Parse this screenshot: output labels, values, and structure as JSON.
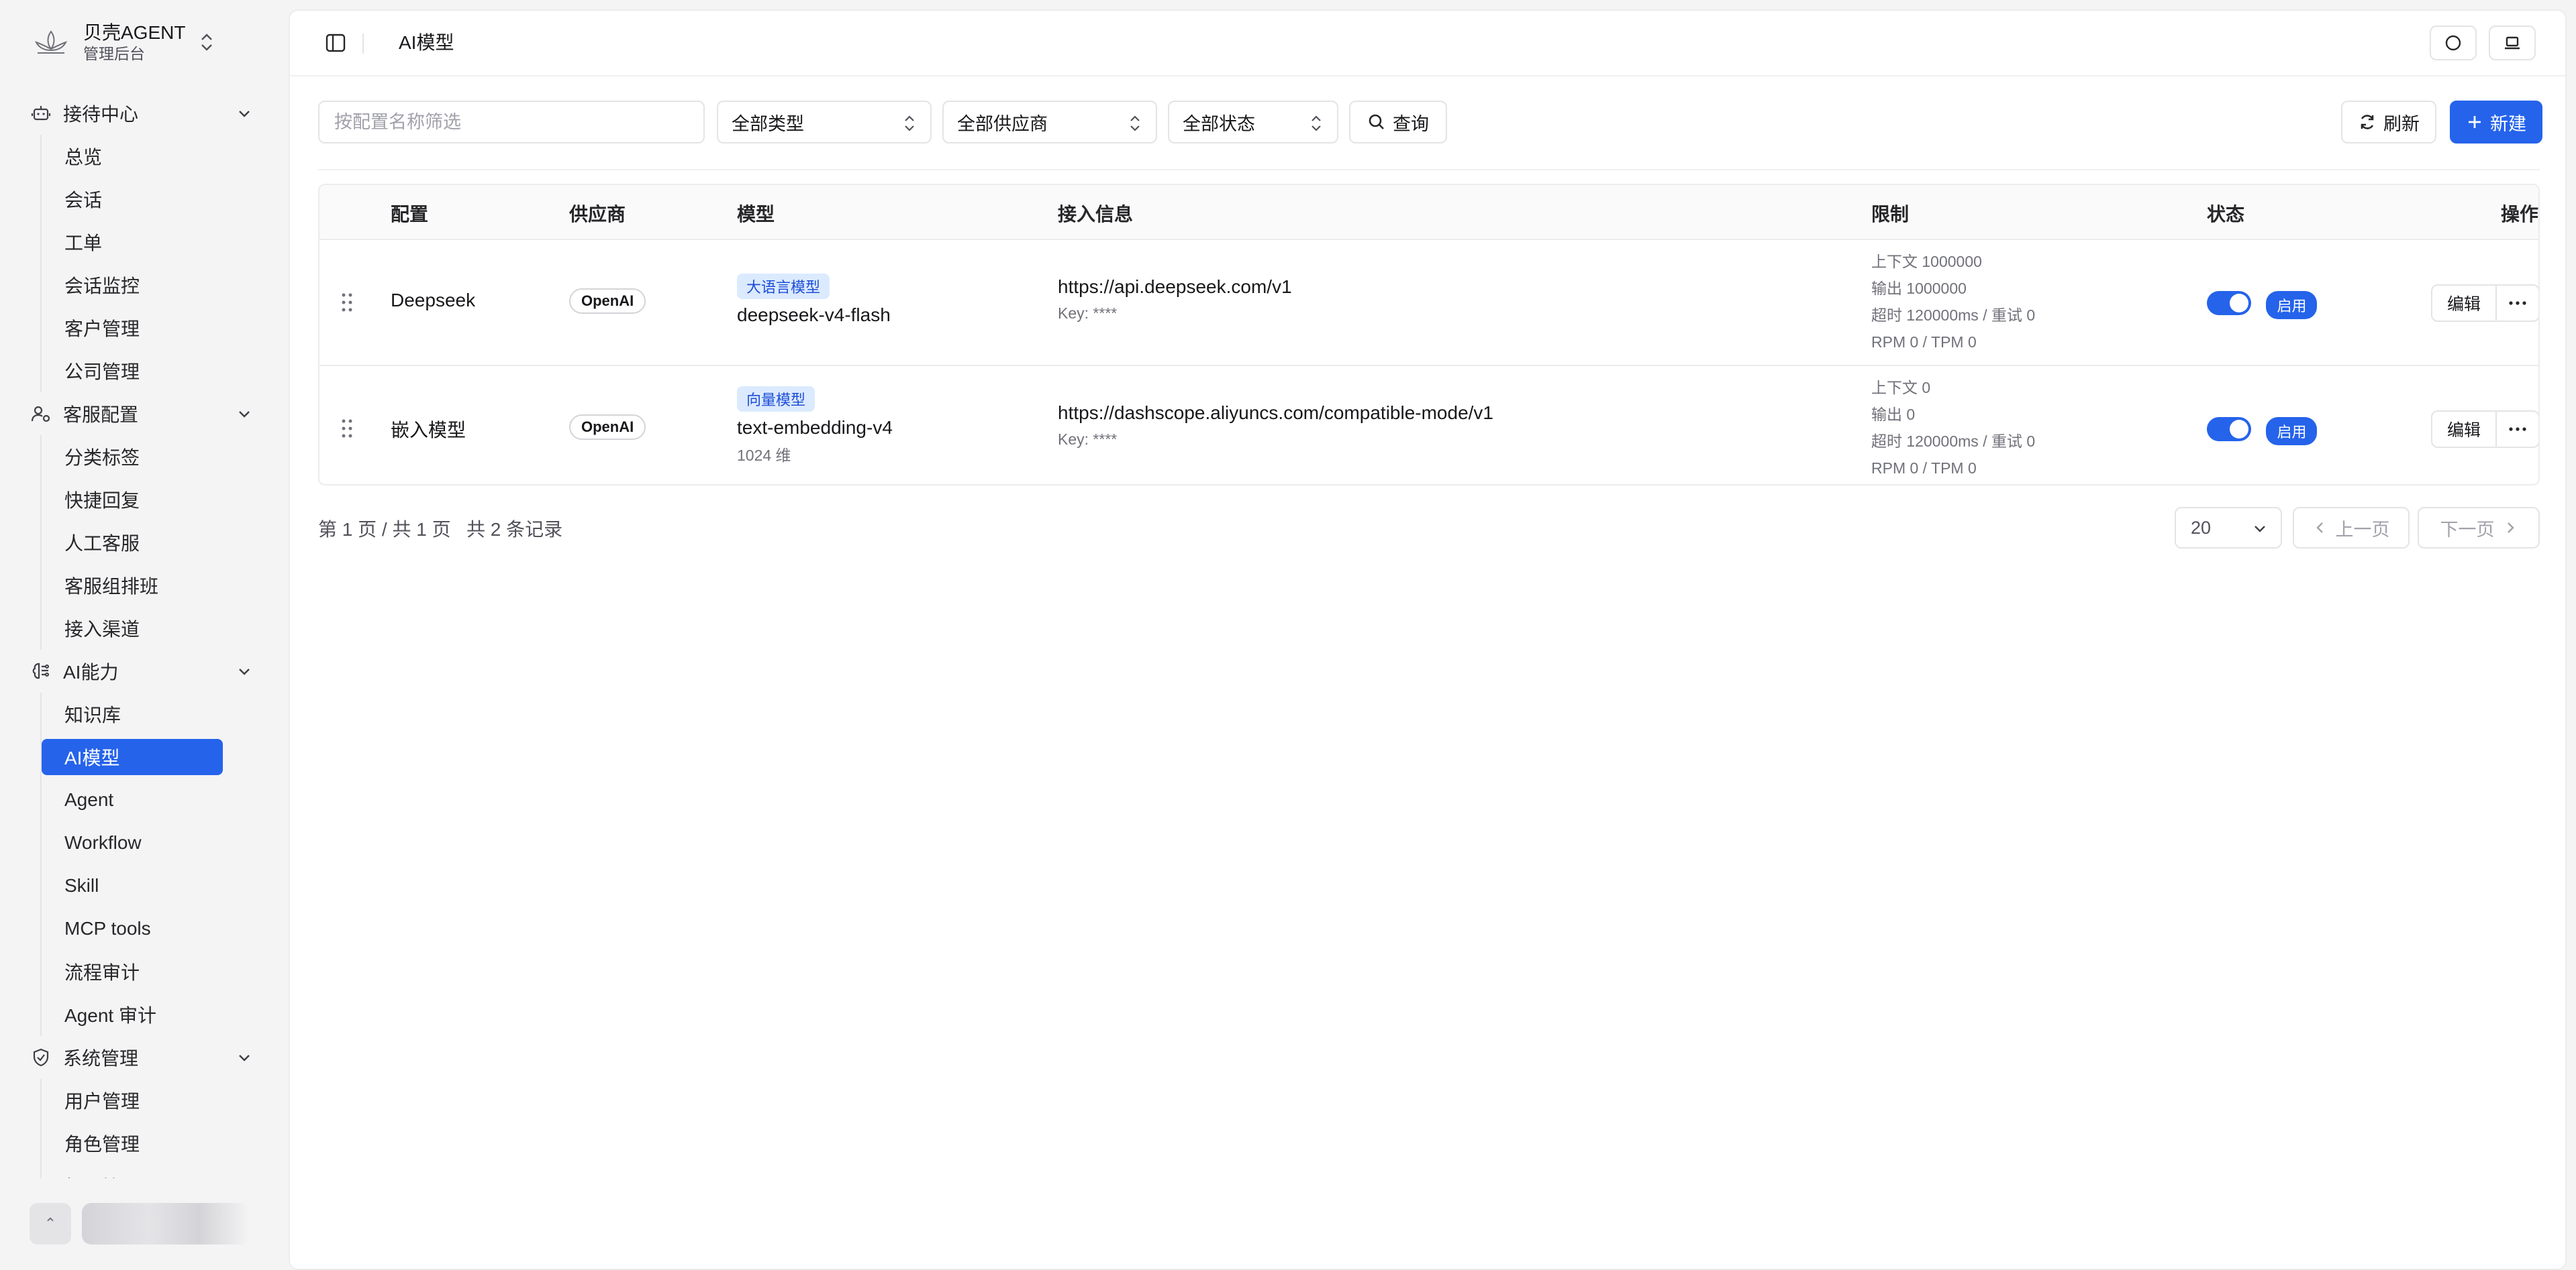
{
  "brand": {
    "title": "贝壳AGENT",
    "subtitle": "管理后台"
  },
  "sidebar": {
    "groups": [
      {
        "label": "接待中心",
        "items": [
          "总览",
          "会话",
          "工单",
          "会话监控",
          "客户管理",
          "公司管理"
        ]
      },
      {
        "label": "客服配置",
        "items": [
          "分类标签",
          "快捷回复",
          "人工客服",
          "客服组排班",
          "接入渠道"
        ]
      },
      {
        "label": "AI能力",
        "items": [
          "知识库",
          "AI模型",
          "Agent",
          "Workflow",
          "Skill",
          "MCP tools",
          "流程审计",
          "Agent 审计"
        ]
      },
      {
        "label": "系统管理",
        "items": [
          "用户管理",
          "角色管理",
          "权限管理"
        ]
      }
    ],
    "active_item": "AI模型"
  },
  "header": {
    "title": "AI模型"
  },
  "filters": {
    "search_placeholder": "按配置名称筛选",
    "type_select": "全部类型",
    "provider_select": "全部供应商",
    "status_select": "全部状态",
    "query_label": "查询",
    "refresh_label": "刷新",
    "new_label": "新建"
  },
  "table": {
    "columns": [
      "配置",
      "供应商",
      "模型",
      "接入信息",
      "限制",
      "状态",
      "操作"
    ],
    "rows": [
      {
        "config": "Deepseek",
        "provider": "OpenAI",
        "model_type": "大语言模型",
        "model_name": "deepseek-v4-flash",
        "model_dim": "",
        "url": "https://api.deepseek.com/v1",
        "key": "Key: ****",
        "limits": [
          "上下文 1000000",
          "输出 1000000",
          "超时 120000ms / 重试 0",
          "RPM 0 / TPM 0"
        ],
        "enabled": true,
        "status": "启用",
        "edit": "编辑"
      },
      {
        "config": "嵌入模型",
        "provider": "OpenAI",
        "model_type": "向量模型",
        "model_name": "text-embedding-v4",
        "model_dim": "1024 维",
        "url": "https://dashscope.aliyuncs.com/compatible-mode/v1",
        "key": "Key: ****",
        "limits": [
          "上下文 0",
          "输出 0",
          "超时 120000ms / 重试 0",
          "RPM 0 / TPM 0"
        ],
        "enabled": true,
        "status": "启用",
        "edit": "编辑"
      }
    ]
  },
  "pagination": {
    "summary": "第 1 页 / 共 1 页   共 2 条记录",
    "page_size": "20",
    "prev": "上一页",
    "next": "下一页"
  },
  "colors": {
    "accent": "#2563eb",
    "tag_bg": "#dbeafe",
    "tag_fg": "#1d4ed8"
  },
  "icons": [
    "lotus-logo-icon",
    "chevrons-updown-icon",
    "bot-icon",
    "user-cog-icon",
    "brain-icon",
    "shield-check-icon",
    "sidebar-toggle-icon",
    "circle-icon",
    "laptop-icon",
    "search-icon",
    "refresh-icon",
    "plus-icon",
    "grip-icon",
    "more-icon",
    "chevron-down-icon",
    "chevron-left-icon",
    "chevron-right-icon"
  ]
}
